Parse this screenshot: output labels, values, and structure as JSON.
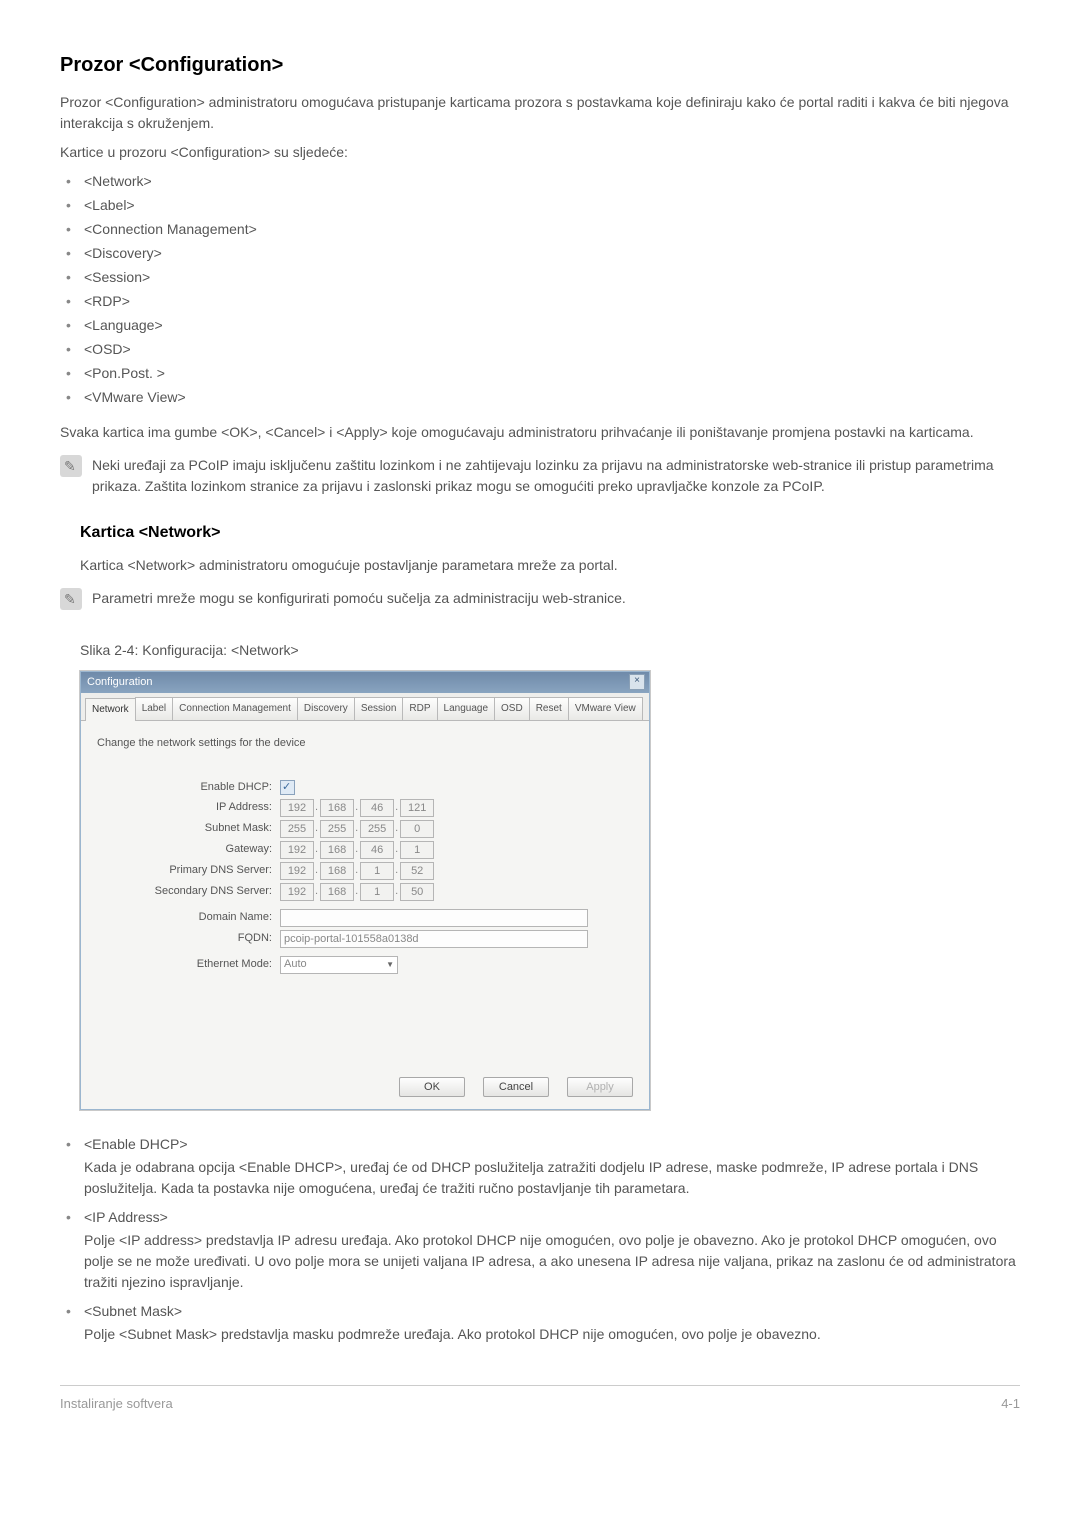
{
  "title": "Prozor <Configuration>",
  "intro1": "Prozor <Configuration> administratoru omogućava pristupanje karticama prozora s postavkama koje definiraju kako će portal raditi i kakva će biti njegova interakcija s okruženjem.",
  "intro2": "Kartice u prozoru <Configuration> su sljedeće:",
  "config_tabs": [
    "<Network>",
    "<Label>",
    "<Connection Management>",
    "<Discovery>",
    "<Session>",
    "<RDP>",
    "<Language>",
    "<OSD>",
    "<Pon.Post. >",
    "<VMware View>"
  ],
  "after_tabs": "Svaka kartica ima gumbe <OK>, <Cancel> i <Apply> koje omogućavaju administratoru prihvaćanje ili poništavanje promjena postavki na karticama.",
  "note1": "Neki uređaji za PCoIP imaju isključenu zaštitu lozinkom i ne zahtijevaju lozinku za prijavu na administratorske web-stranice ili pristup parametrima prikaza. Zaštita lozinkom stranice za prijavu i zaslonski prikaz mogu se omogućiti preko upravljačke konzole za PCoIP.",
  "section_network_title": "Kartica <Network>",
  "section_network_p": "Kartica <Network> administratoru omogućuje postavljanje parametara mreže za portal.",
  "note2": "Parametri mreže mogu se konfigurirati pomoću sučelja za administraciju web-stranice.",
  "fig_caption": "Slika 2-4: Konfiguracija: <Network>",
  "dialog": {
    "title": "Configuration",
    "tabs": [
      "Network",
      "Label",
      "Connection Management",
      "Discovery",
      "Session",
      "RDP",
      "Language",
      "OSD",
      "Reset",
      "VMware View"
    ],
    "subhead": "Change the network settings for the device",
    "labels": {
      "enable_dhcp": "Enable DHCP:",
      "ip": "IP Address:",
      "subnet": "Subnet Mask:",
      "gateway": "Gateway:",
      "pdns": "Primary DNS Server:",
      "sdns": "Secondary DNS Server:",
      "domain": "Domain Name:",
      "fqdn": "FQDN:",
      "eth": "Ethernet Mode:"
    },
    "values": {
      "ip": [
        "192",
        "168",
        "46",
        "121"
      ],
      "subnet": [
        "255",
        "255",
        "255",
        "0"
      ],
      "gateway": [
        "192",
        "168",
        "46",
        "1"
      ],
      "pdns": [
        "192",
        "168",
        "1",
        "52"
      ],
      "sdns": [
        "192",
        "168",
        "1",
        "50"
      ],
      "fqdn": "pcoip-portal-101558a0138d",
      "eth": "Auto"
    },
    "buttons": {
      "ok": "OK",
      "cancel": "Cancel",
      "apply": "Apply"
    }
  },
  "details": [
    {
      "t": "<Enable DHCP>",
      "d": "Kada je odabrana opcija <Enable DHCP>, uređaj će od DHCP poslužitelja zatražiti dodjelu IP adrese, maske podmreže, IP adrese portala i DNS poslužitelja. Kada ta postavka nije omogućena, uređaj će tražiti ručno postavljanje tih parametara."
    },
    {
      "t": "<IP Address>",
      "d": "Polje <IP address> predstavlja IP adresu uređaja. Ako protokol DHCP nije omogućen, ovo polje je obavezno. Ako je protokol DHCP omogućen, ovo polje se ne može uređivati. U ovo polje mora se unijeti valjana IP adresa, a ako unesena IP adresa nije valjana, prikaz na zaslonu će od administratora tražiti njezino ispravljanje."
    },
    {
      "t": "<Subnet Mask>",
      "d": "Polje <Subnet Mask> predstavlja masku podmreže uređaja. Ako protokol DHCP nije omogućen, ovo polje je obavezno."
    }
  ],
  "footer": {
    "left": "Instaliranje softvera",
    "right": "4-1"
  }
}
